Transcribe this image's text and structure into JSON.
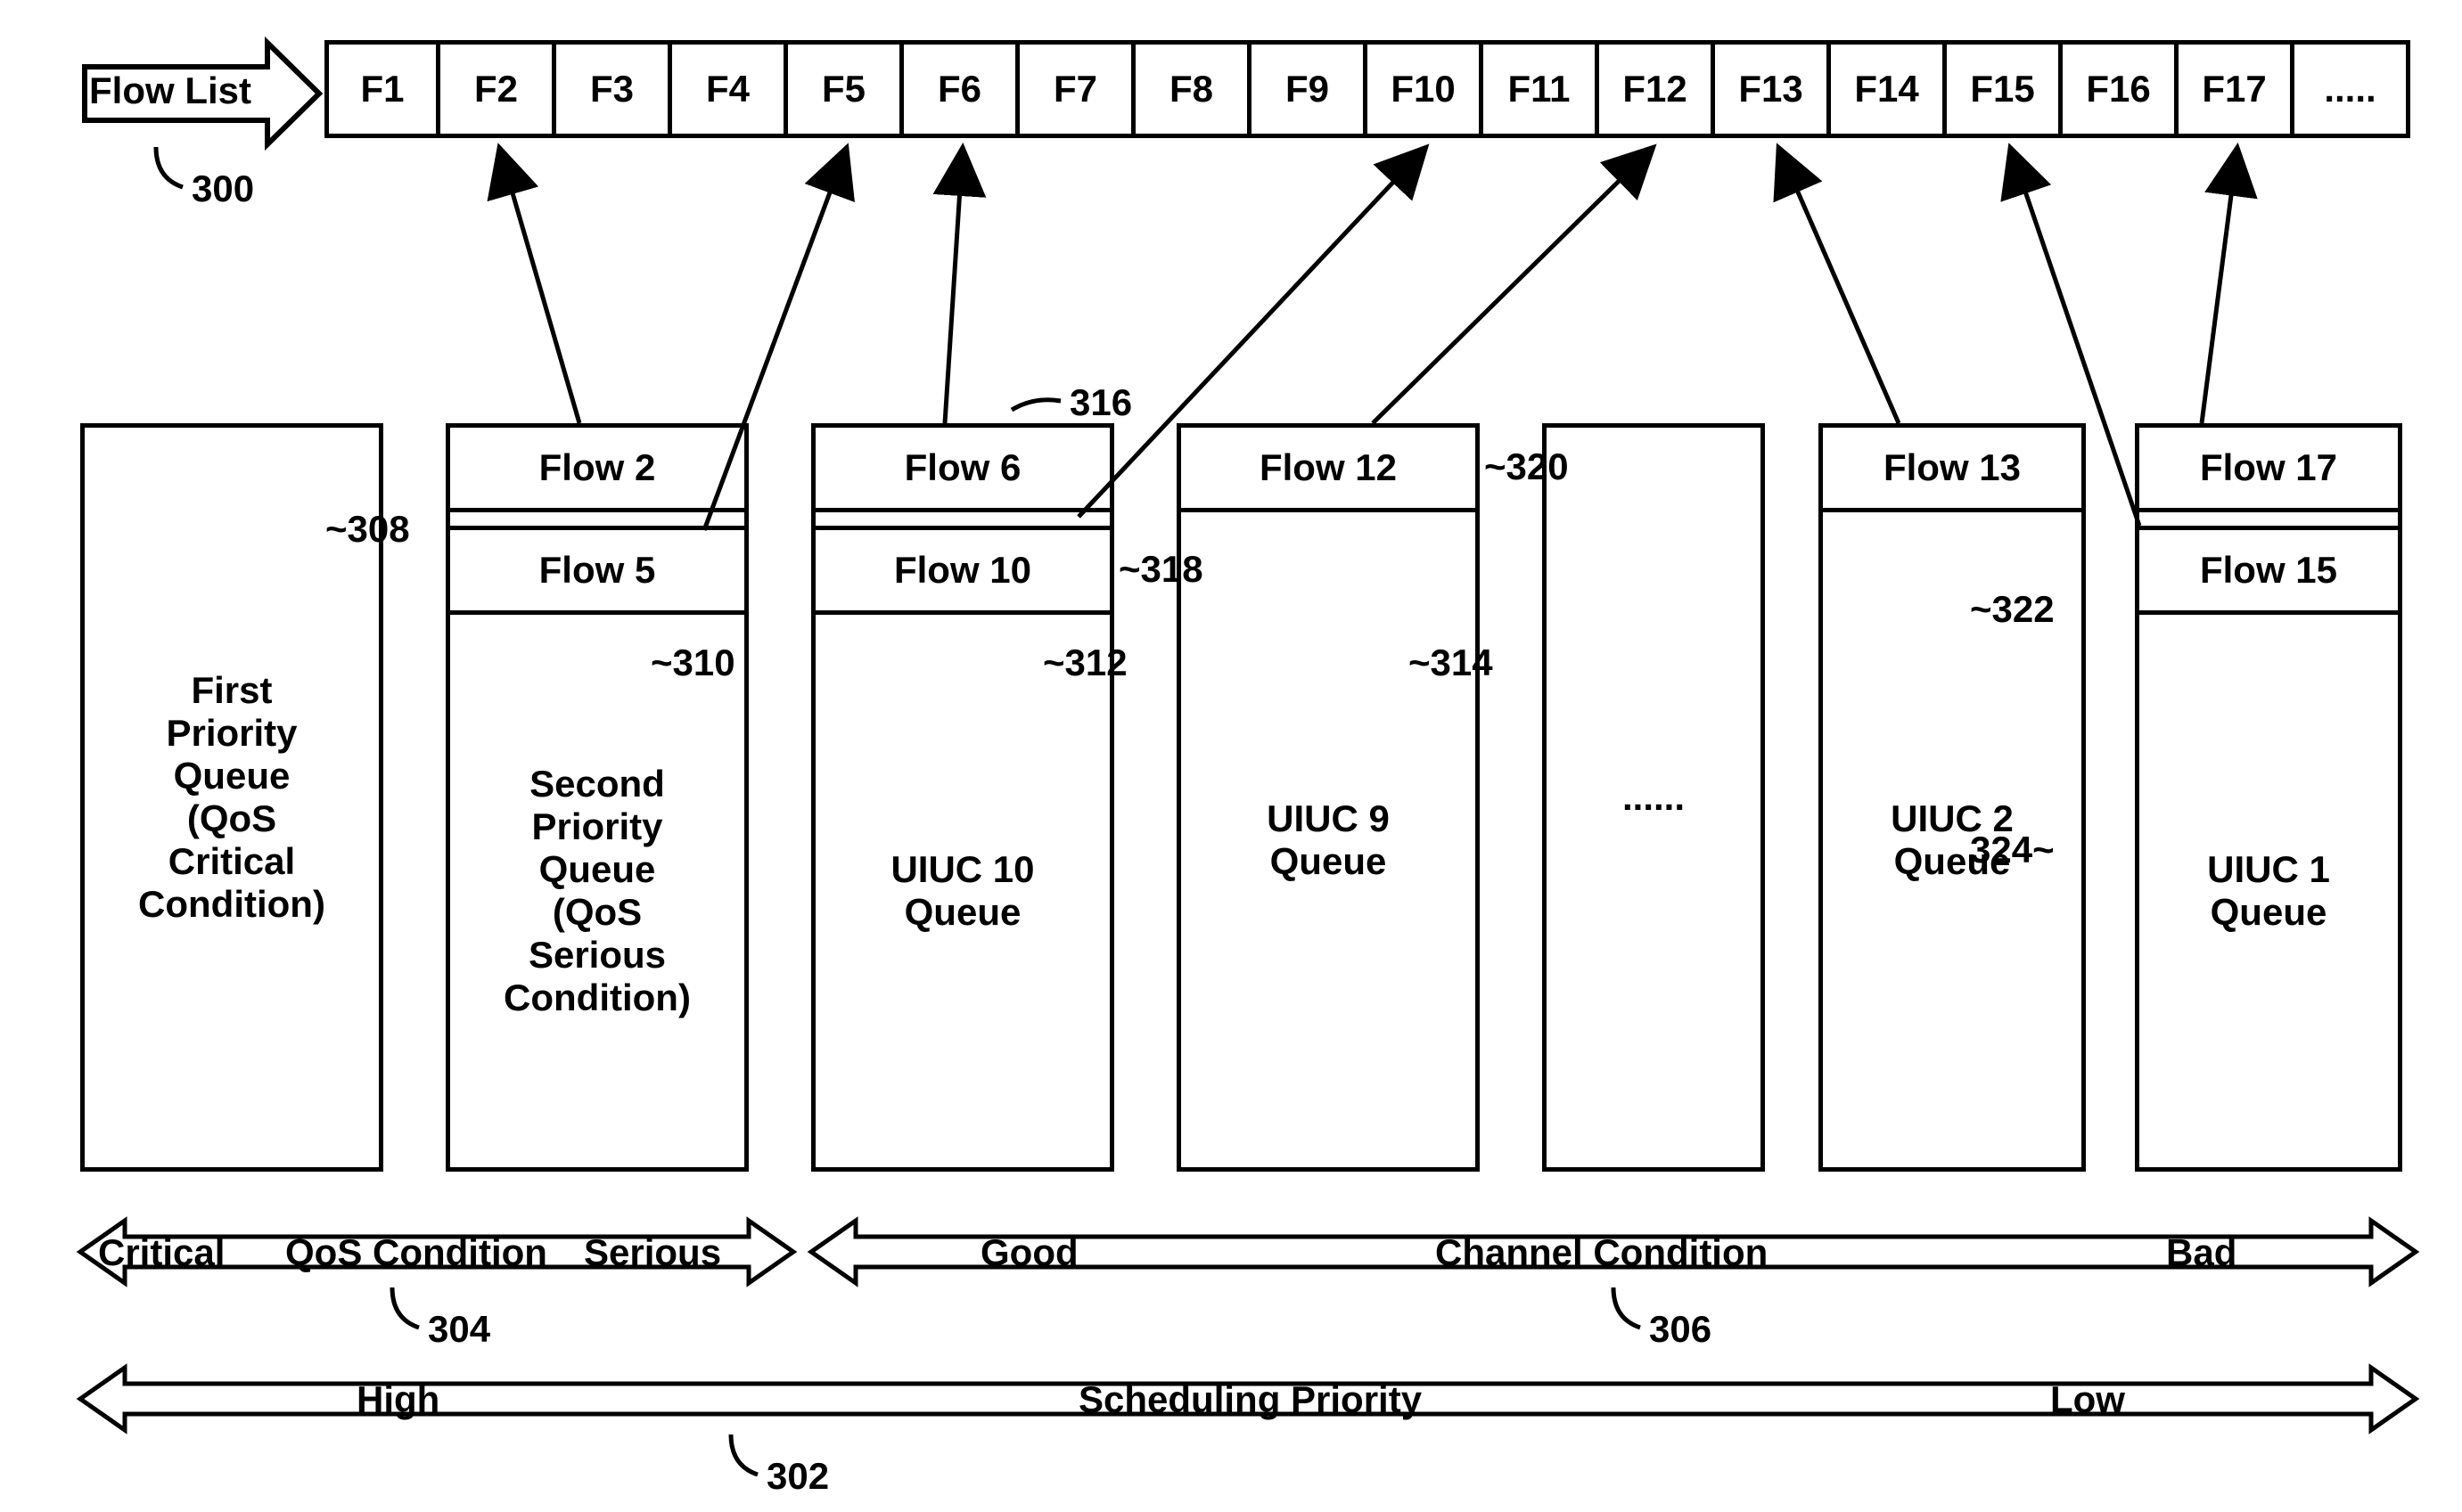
{
  "flow_list_label": "Flow List",
  "flow_list_ref": "300",
  "flow_cells": [
    "F1",
    "F2",
    "F3",
    "F4",
    "F5",
    "F6",
    "F7",
    "F8",
    "F9",
    "F10",
    "F11",
    "F12",
    "F13",
    "F14",
    "F15",
    "F16",
    "F17",
    "....."
  ],
  "queues": {
    "q1": {
      "body": "First\nPriority\nQueue\n(QoS\nCritical\nCondition)",
      "ref": "308"
    },
    "q2": {
      "slots": [
        "Flow 2",
        "Flow 5"
      ],
      "body": "Second\nPriority\nQueue\n(QoS\nSerious\nCondition)",
      "ref": "310"
    },
    "q3": {
      "slots": [
        "Flow 6",
        "Flow 10"
      ],
      "body": "UIUC 10\nQueue",
      "ref_top": "316",
      "ref_mid": "318",
      "ref": "312"
    },
    "q4": {
      "slots": [
        "Flow 12"
      ],
      "body": "UIUC 9\nQueue",
      "ref_top": "320",
      "ref": "314"
    },
    "q5": {
      "body": "......"
    },
    "q6": {
      "slots": [
        "Flow 13"
      ],
      "body": "UIUC 2\nQueue",
      "ref": "322"
    },
    "q7": {
      "slots": [
        "Flow 17",
        "Flow 15"
      ],
      "body": "UIUC 1\nQueue",
      "ref": "324"
    }
  },
  "axis_qos": {
    "left": "Critical",
    "mid": "QoS Condition",
    "right": "Serious",
    "ref": "304"
  },
  "axis_channel": {
    "left": "Good",
    "mid": "Channel Condition",
    "right": "Bad",
    "ref": "306"
  },
  "axis_priority": {
    "left": "High",
    "mid": "Scheduling Priority",
    "right": "Low",
    "ref": "302"
  }
}
